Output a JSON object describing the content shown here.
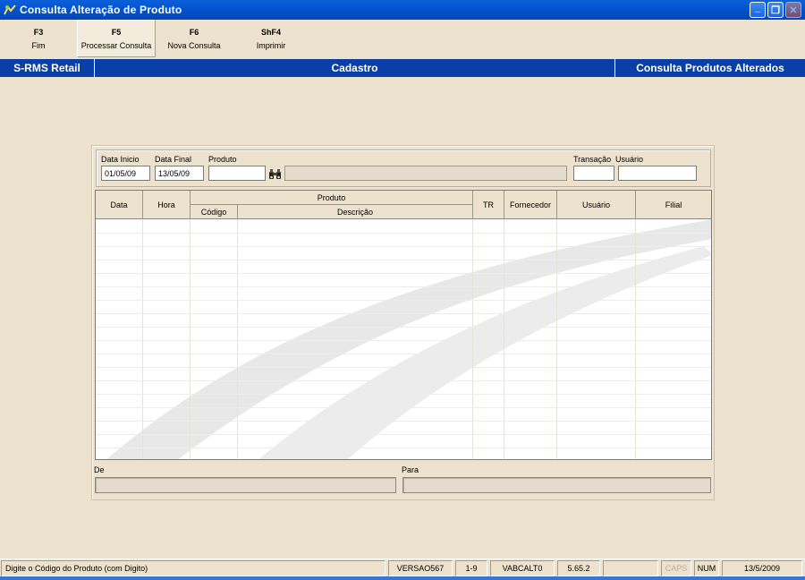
{
  "window": {
    "title": "Consulta Alteração de Produto",
    "buttons": {
      "minimize": "_",
      "restore": "❐",
      "close": "✕"
    }
  },
  "toolbar": {
    "buttons": [
      {
        "key": "F3",
        "label": "Fim"
      },
      {
        "key": "F5",
        "label": "Processar Consulta"
      },
      {
        "key": "F6",
        "label": "Nova Consulta"
      },
      {
        "key": "ShF4",
        "label": "Imprimir"
      }
    ]
  },
  "band": {
    "left": "S-RMS Retail",
    "center": "Cadastro",
    "right": "Consulta Produtos Alterados"
  },
  "filters": {
    "data_inicio_label": "Data Inicio",
    "data_inicio_value": "01/05/09",
    "data_final_label": "Data Final",
    "data_final_value": "13/05/09",
    "produto_label": "Produto",
    "produto_value": "",
    "produto_desc": "",
    "transacao_label": "Transação",
    "transacao_value": "",
    "usuario_label": "Usuário",
    "usuario_value": ""
  },
  "grid": {
    "headers": {
      "data": "Data",
      "hora": "Hora",
      "produto": "Produto",
      "codigo": "Código",
      "descricao": "Descrição",
      "tr": "TR",
      "fornecedor": "Fornecedor",
      "usuario": "Usuário",
      "filial": "Filial"
    },
    "rows": []
  },
  "de_para": {
    "de_label": "De",
    "para_label": "Para",
    "de_value": "",
    "para_value": ""
  },
  "status": {
    "message": "Digite o Código do Produto (com Digito)",
    "version": "VERSAO567",
    "page": "1-9",
    "program": "VABCALT0",
    "build": "5.65.2",
    "blank": "",
    "caps": "CAPS",
    "num": "NUM",
    "date": "13/5/2009"
  },
  "colors": {
    "titlebar": "#0454d0",
    "band": "#0a3fa8",
    "background": "#ece2cd"
  }
}
